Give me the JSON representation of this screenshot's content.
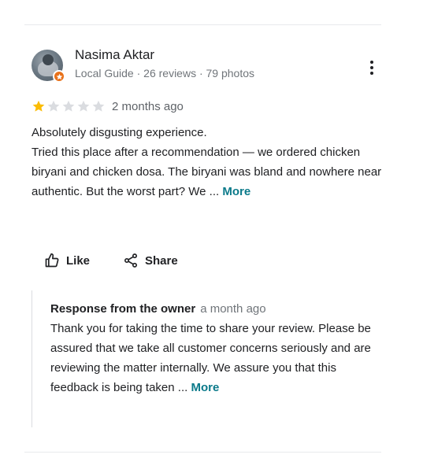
{
  "reviewer": {
    "name": "Nasima Aktar",
    "meta": "Local Guide · 26 reviews · 79 photos",
    "badge_color": "#e8711a"
  },
  "rating": {
    "stars": 1,
    "max_stars": 5,
    "filled_color": "#fbbc04",
    "empty_color": "#dadce0",
    "date": "2 months ago"
  },
  "review": {
    "line1": "Absolutely disgusting experience.",
    "body": "Tried this place after a recommendation — we ordered chicken biryani and chicken dosa. The biryani was bland and nowhere near authentic. But the worst part? We ... ",
    "more_label": "More"
  },
  "actions": {
    "like_label": "Like",
    "share_label": "Share"
  },
  "owner_response": {
    "title": "Response from the owner",
    "date": "a month ago",
    "body": "Thank you for taking the time to share your review. Please be assured that we take all customer concerns seriously and are reviewing the matter internally. We assure you that this feedback is being taken ... ",
    "more_label": "More"
  },
  "icons": {
    "menu": "more-vert-icon",
    "like": "thumb-up-icon",
    "share": "share-icon",
    "badge": "local-guide-star-icon"
  }
}
